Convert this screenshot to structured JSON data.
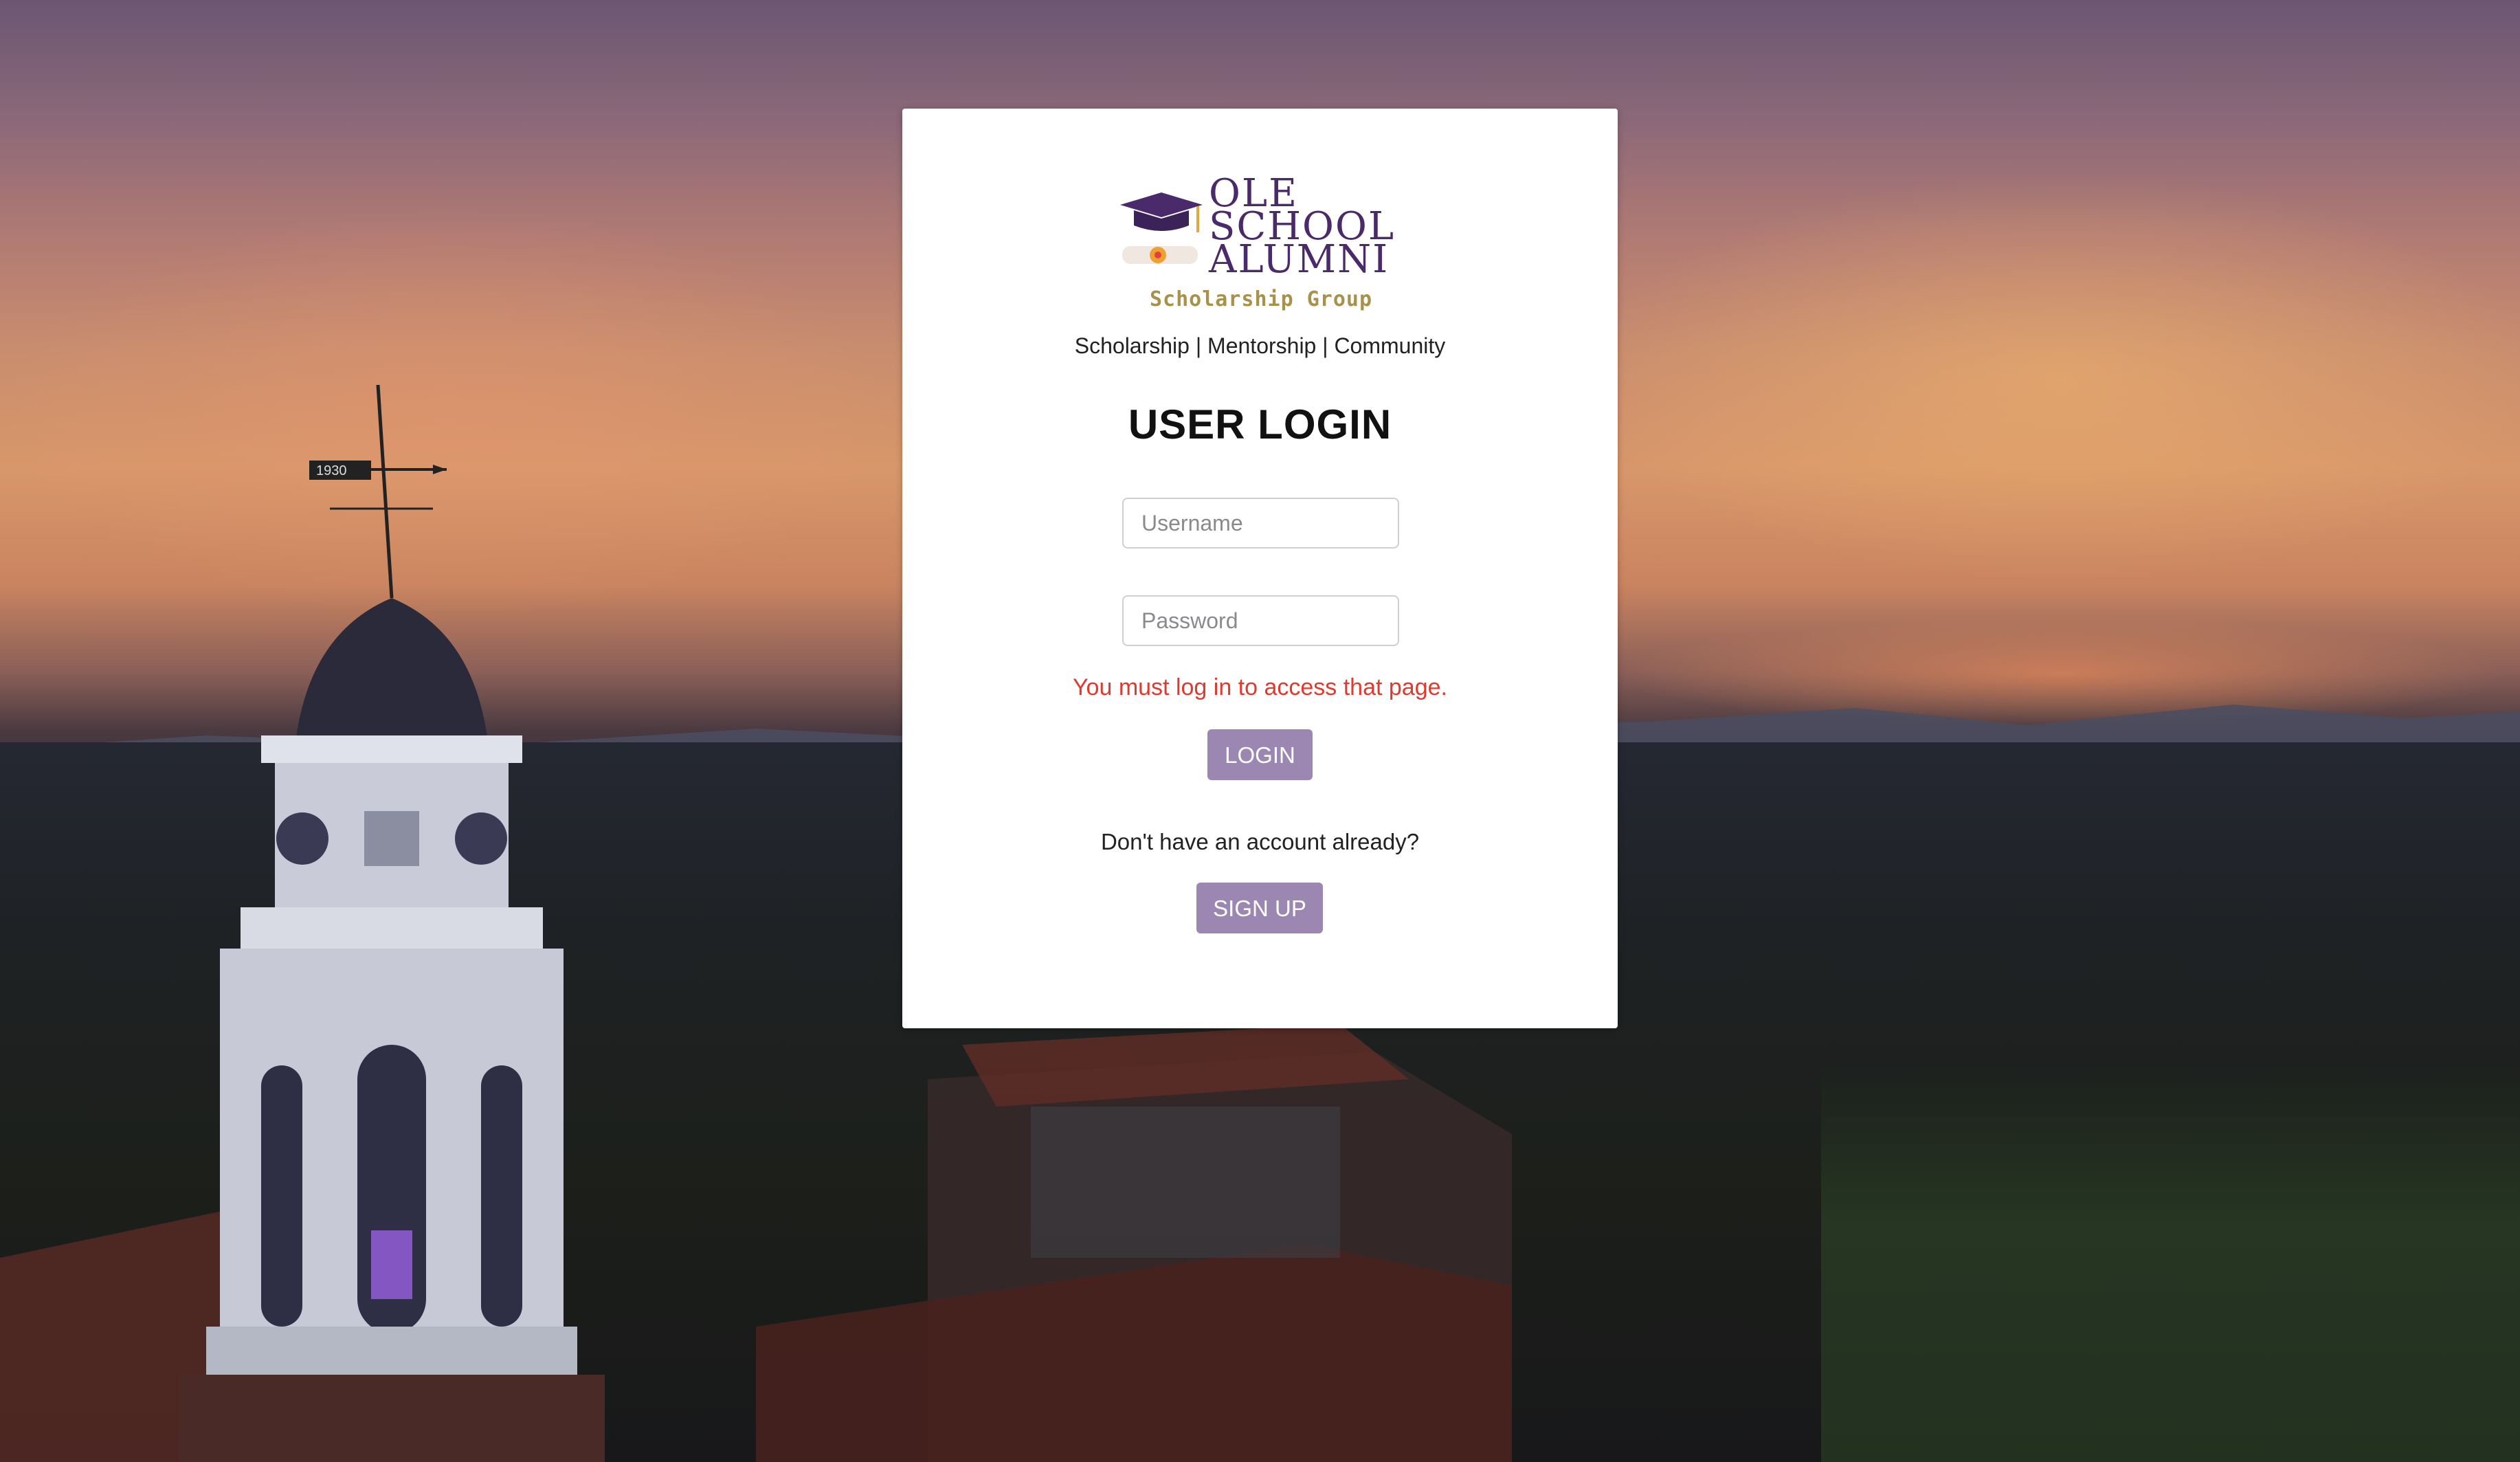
{
  "brand": {
    "logo_lines": [
      "OLE",
      "SCHOOL",
      "ALUMNI"
    ],
    "logo_subtitle": "Scholarship Group",
    "tagline": "Scholarship | Mentorship | Community",
    "logo_icon": "graduation-cap-icon",
    "colors": {
      "logo_purple": "#4a2a6a",
      "logo_gold": "#a8924a"
    }
  },
  "login": {
    "title": "USER LOGIN",
    "username_placeholder": "Username",
    "username_value": "",
    "password_placeholder": "Password",
    "password_value": "",
    "error_message": "You must log in to access that page.",
    "login_button": "LOGIN",
    "signup_prompt": "Don't have an account already?",
    "signup_button": "SIGN UP"
  },
  "theme": {
    "button_color": "#9b87b2",
    "error_color": "#e03a2f",
    "card_background": "#ffffff"
  },
  "background": {
    "weathervane_label": "1930"
  }
}
